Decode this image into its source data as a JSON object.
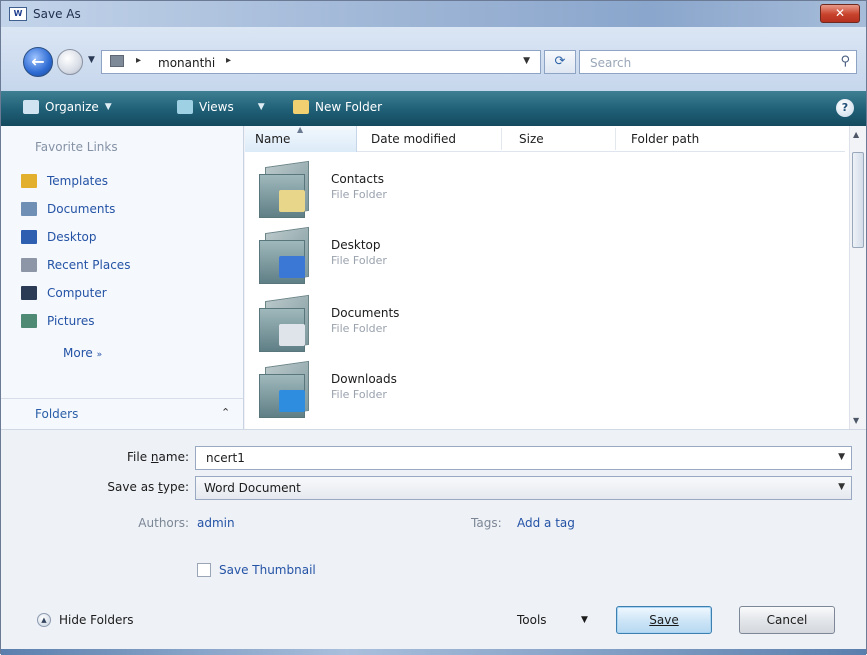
{
  "window": {
    "title": "Save As",
    "app_icon_text": "W"
  },
  "address": {
    "crumbs": [
      "monanthi"
    ],
    "search_placeholder": "Search"
  },
  "toolbar": {
    "organize": "Organize",
    "views": "Views",
    "new_folder": "New Folder"
  },
  "favorites": {
    "heading": "Favorite Links",
    "items": [
      {
        "label": "Templates",
        "icon": "templates-folder-icon",
        "color": "#e3b02e"
      },
      {
        "label": "Documents",
        "icon": "documents-icon",
        "color": "#6f8fb5"
      },
      {
        "label": "Desktop",
        "icon": "desktop-icon",
        "color": "#2f5fb0"
      },
      {
        "label": "Recent Places",
        "icon": "recent-places-icon",
        "color": "#8c96a6"
      },
      {
        "label": "Computer",
        "icon": "computer-icon",
        "color": "#2c3b55"
      },
      {
        "label": "Pictures",
        "icon": "pictures-icon",
        "color": "#4f8a74"
      }
    ],
    "more": "More",
    "folders_label": "Folders"
  },
  "columns": [
    "Name",
    "Date modified",
    "Size",
    "Folder path"
  ],
  "files": [
    {
      "name": "Contacts",
      "type": "File Folder",
      "badge": "contacts-badge-icon",
      "badge_color": "#e8d68a"
    },
    {
      "name": "Desktop",
      "type": "File Folder",
      "badge": "desktop-badge-icon",
      "badge_color": "#3b78d6"
    },
    {
      "name": "Documents",
      "type": "File Folder",
      "badge": "documents-badge-icon",
      "badge_color": "#dfe4ea"
    },
    {
      "name": "Downloads",
      "type": "File Folder",
      "badge": "downloads-badge-icon",
      "badge_color": "#2f8de0"
    }
  ],
  "form": {
    "file_name_label_pre": "File ",
    "file_name_label_ul": "n",
    "file_name_label_post": "ame:",
    "file_name_value": "ncert1",
    "save_type_label_pre": "Save as ",
    "save_type_label_ul": "t",
    "save_type_label_post": "ype:",
    "save_type_value": "Word Document",
    "authors_label": "Authors:",
    "authors_value": "admin",
    "tags_label": "Tags:",
    "tags_value": "Add a tag",
    "save_thumbnail": "Save Thumbnail",
    "hide_folders": "Hide Folders",
    "tools": "Tools",
    "save_button": "Save",
    "cancel_button": "Cancel"
  }
}
